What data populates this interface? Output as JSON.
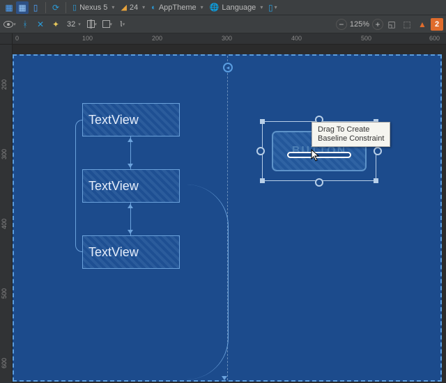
{
  "toolbar1": {
    "device": "Nexus 5",
    "api": "24",
    "theme": "AppTheme",
    "lang": "Language"
  },
  "toolbar2": {
    "autoconnect_value": "32",
    "zoom": "125%",
    "notifications": "2"
  },
  "ruler_top": [
    "0",
    "100",
    "200",
    "300",
    "400",
    "500",
    "600"
  ],
  "ruler_left": [
    "200",
    "300",
    "400",
    "500",
    "600"
  ],
  "components": {
    "tv1": "TextView",
    "tv2": "TextView",
    "tv3": "TextView",
    "button_label": "BUTTON"
  },
  "tooltip": {
    "line1": "Drag To Create",
    "line2": "Baseline Constraint"
  }
}
